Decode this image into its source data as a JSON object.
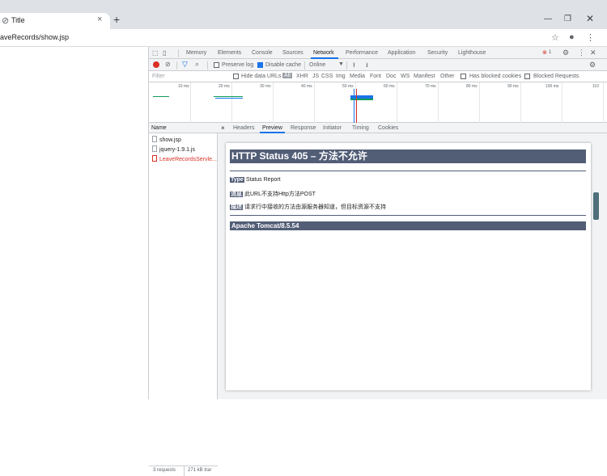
{
  "browser": {
    "tab_title": "Title",
    "tab_close": "×",
    "new_tab": "+",
    "url": "aveRecords/show.jsp",
    "icons": [
      "globe-icon",
      "star-icon",
      "account-icon",
      "menu-icon"
    ]
  },
  "devtools": {
    "tabs": [
      "Memory",
      "Elements",
      "Console",
      "Sources",
      "Network",
      "Performance",
      "Application",
      "Security",
      "Lighthouse"
    ],
    "error_count": "1",
    "toolbar": {
      "preserve_log": "Preserve log",
      "disable_cache": "Disable cache",
      "throttle": "Online"
    },
    "filter": {
      "placeholder": "Filter",
      "hide_data_urls": "Hide data URLs",
      "types": [
        "All",
        "XHR",
        "JS",
        "CSS",
        "Img",
        "Media",
        "Font",
        "Doc",
        "WS",
        "Manifest",
        "Other"
      ],
      "has_blocked_cookies": "Has blocked cookies",
      "blocked_requests": "Blocked Requests"
    },
    "timeline_ticks": [
      "10 ms",
      "20 ms",
      "30 ms",
      "40 ms",
      "50 ms",
      "60 ms",
      "70 ms",
      "80 ms",
      "90 ms",
      "100 ms",
      "110"
    ],
    "name_header": "Name",
    "requests": [
      {
        "name": "show.jsp",
        "error": false
      },
      {
        "name": "jquery-1.9.1.js",
        "error": false
      },
      {
        "name": "LeaveRecordsServle...",
        "error": true
      }
    ],
    "detail_close": "×",
    "detail_tabs": [
      "Headers",
      "Preview",
      "Response",
      "Initiator",
      "Timing",
      "Cookies"
    ],
    "status_bar": {
      "requests": "3 requests",
      "size": "271 kB trar"
    }
  },
  "preview": {
    "title": "HTTP Status 405 – 方法不允许",
    "type_label": "Type",
    "type_value": "Status Report",
    "message_label": "消息",
    "message_value": "此URL不支持Http方法POST",
    "description_label": "描述",
    "description_value": "请求行中接收的方法由源服务器知道，但目标资源不支持",
    "footer": "Apache Tomcat/8.5.54"
  },
  "colors": {
    "accent": "#1a73e8",
    "tomcat_bar": "#525d76",
    "error": "#d93025"
  }
}
